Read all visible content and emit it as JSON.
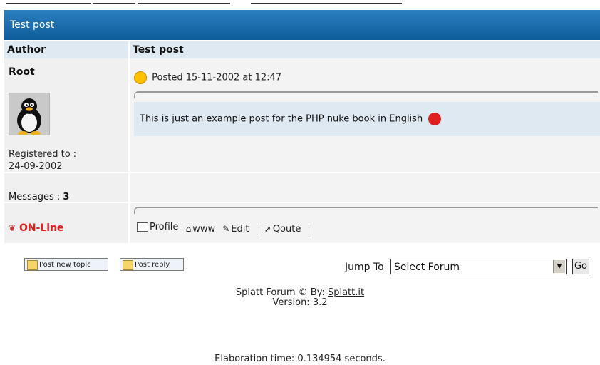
{
  "topic_title": "Test post",
  "headers": {
    "author": "Author",
    "topic": "Test post"
  },
  "author": {
    "name": "Root",
    "avatar_icon": "tux-penguin-avatar",
    "registered_label": "Registered to :",
    "registered_date": "24-09-2002",
    "messages_label": "Messages :",
    "messages_count": "3",
    "status": "ON-Line"
  },
  "post": {
    "posted": "Posted 15-11-2002 at 12:47",
    "message": "This is just an example post for the PHP nuke book in English"
  },
  "actions": {
    "profile": "Profile",
    "www": "www",
    "edit": "Edit",
    "quote": "Qoute"
  },
  "buttons": {
    "new_topic": "Post new topic",
    "reply": "Post reply"
  },
  "jump": {
    "label": "Jump To",
    "selected": "Select Forum",
    "go": "Go"
  },
  "footer": {
    "credit_prefix": "Splatt Forum © By: ",
    "credit_link": "Splatt.it",
    "version": "Version: 3.2",
    "elaboration": "Elaboration time: 0.134954 seconds."
  },
  "colors": {
    "title_bar": "#0e5c9a",
    "header_bg": "#dfe9f2",
    "online": "#e02020"
  }
}
